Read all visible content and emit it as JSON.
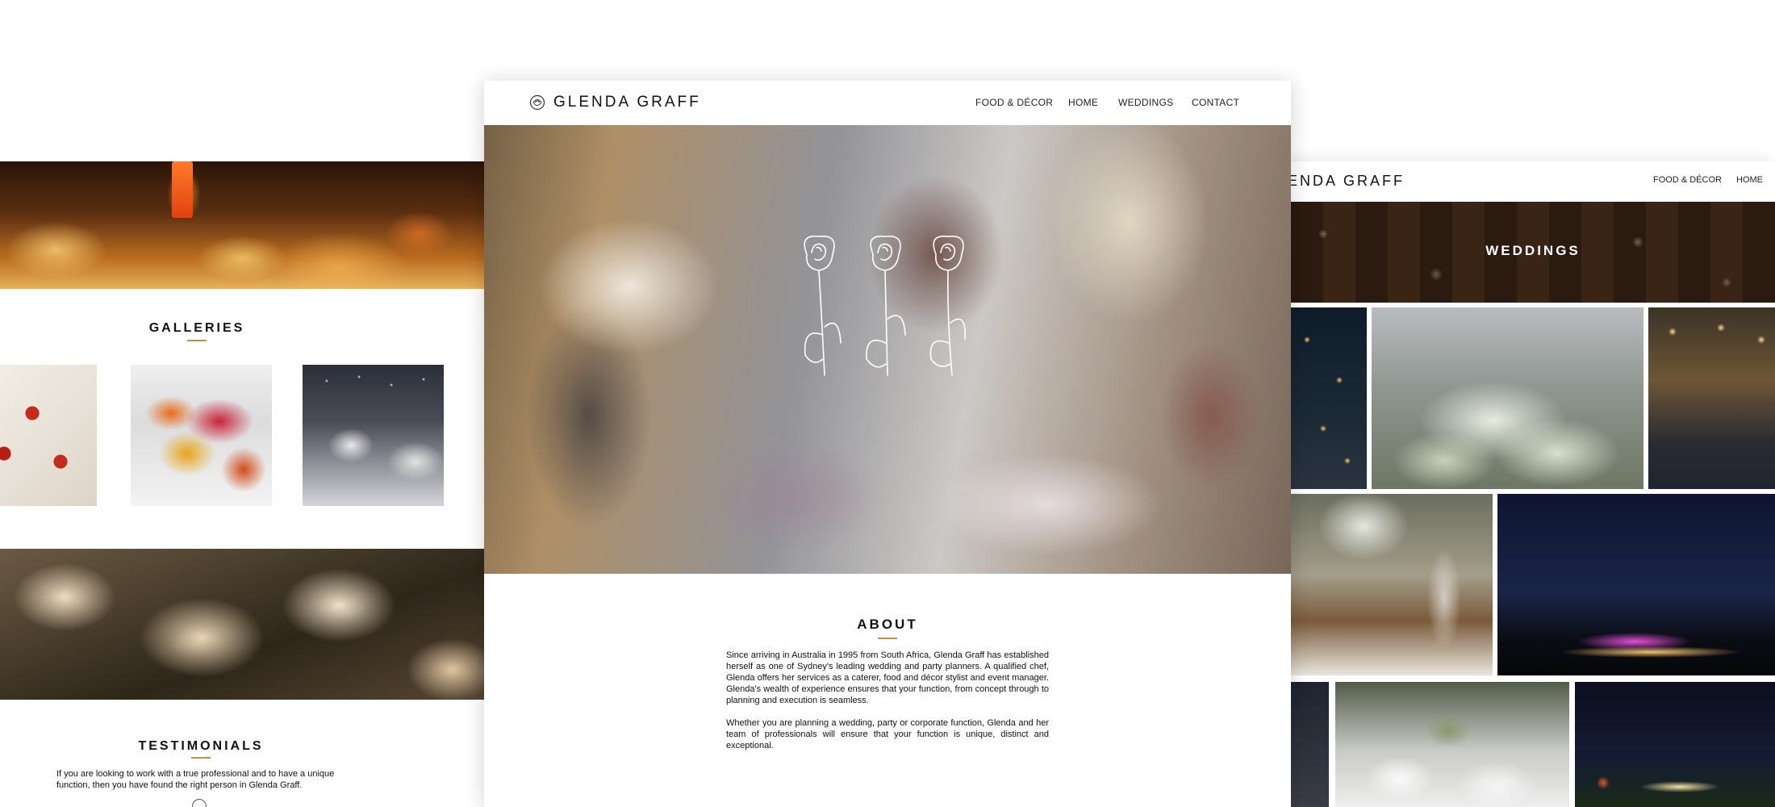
{
  "left_page": {
    "galleries_title": "GALLERIES",
    "testimonials_title": "TESTIMONIALS",
    "testimonial_text": "If you are looking to work with a true professional and to have a unique function, then you have found the right person in Glenda Graff."
  },
  "center_page": {
    "brand": "GLENDA GRAFF",
    "nav": [
      "FOOD & DÉCOR",
      "HOME",
      "WEDDINGS",
      "CONTACT"
    ],
    "about_title": "ABOUT",
    "about_paragraphs": [
      "Since arriving in Australia in 1995 from South Africa, Glenda Graff has established herself as one of Sydney's leading wedding and party planners. A qualified chef, Glenda offers her services as a caterer, food and décor stylist and event manager. Glenda's wealth of experience ensures that your function, from concept through to planning and execution is seamless.",
      "Whether you are planning a wedding, party or corporate function, Glenda and her team of professionals will ensure that your function is unique, distinct and exceptional."
    ]
  },
  "right_page": {
    "brand_partial": "ENDA GRAFF",
    "nav": [
      "FOOD & DÉCOR",
      "HOME"
    ],
    "banner_title": "WEDDINGS"
  },
  "colors": {
    "accent": "#c28f42",
    "text": "#111111",
    "background": "#ffffff"
  },
  "icons": {
    "logo": "rose-logo-icon",
    "hero": "three-roses-illustration"
  }
}
